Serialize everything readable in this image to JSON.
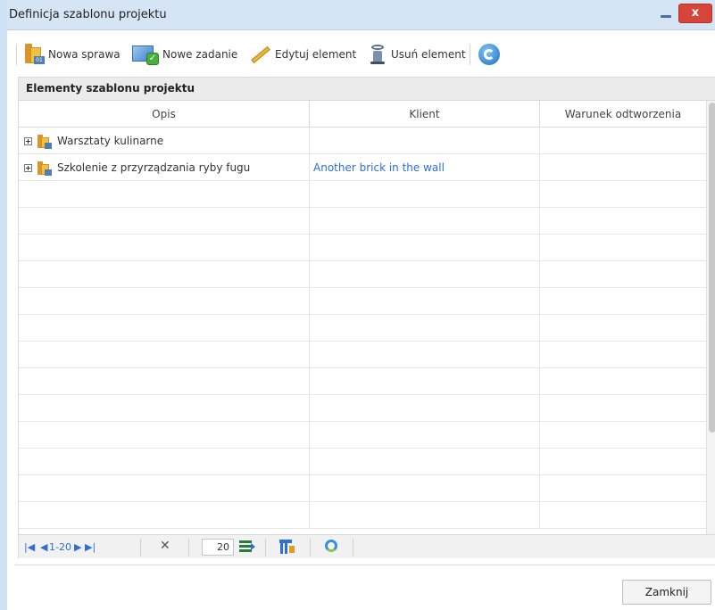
{
  "window": {
    "title": "Definicja szablonu projektu",
    "close_glyph": "x"
  },
  "toolbar": {
    "new_case_label": "Nowa sprawa",
    "new_task_label": "Nowe zadanie",
    "edit_label": "Edytuj element",
    "delete_label": "Usuń element"
  },
  "panel": {
    "title": "Elementy szablonu projektu"
  },
  "grid": {
    "columns": [
      "Opis",
      "Klient",
      "Warunek odtworzenia"
    ],
    "rows": [
      {
        "opis": "Warsztaty kulinarne",
        "klient": "",
        "warunek": ""
      },
      {
        "opis": "Szkolenie z przyrządzania ryby fugu",
        "klient": "Another brick in the wall",
        "warunek": ""
      }
    ]
  },
  "pager": {
    "range_text": "1-20",
    "page_size": "20"
  },
  "footer": {
    "close_label": "Zamknij"
  },
  "icons": {
    "new_case": "folder-document-icon",
    "new_task": "task-icon",
    "edit": "pencil-icon",
    "delete": "delete-icon",
    "refresh": "refresh-icon"
  }
}
